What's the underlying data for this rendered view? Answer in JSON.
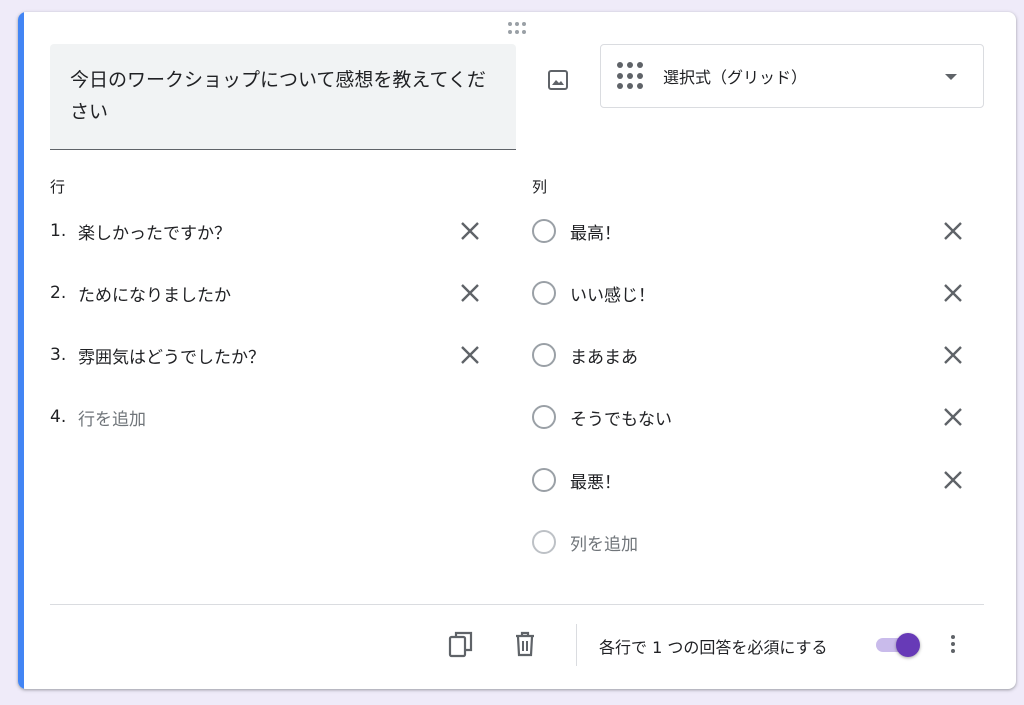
{
  "question": {
    "title": "今日のワークショップについて感想を教えてください",
    "type_label": "選択式（グリッド）"
  },
  "rows": {
    "heading": "行",
    "items": [
      {
        "num": "1.",
        "label": "楽しかったですか？"
      },
      {
        "num": "2.",
        "label": "ためになりましたか"
      },
      {
        "num": "3.",
        "label": "雰囲気はどうでしたか？"
      }
    ],
    "add": {
      "num": "4.",
      "label": "行を追加"
    }
  },
  "columns": {
    "heading": "列",
    "items": [
      {
        "label": "最高！"
      },
      {
        "label": "いい感じ！"
      },
      {
        "label": "まあまあ"
      },
      {
        "label": "そうでもない"
      },
      {
        "label": "最悪！"
      }
    ],
    "add": {
      "label": "列を追加"
    }
  },
  "footer": {
    "required_label": "各行で 1 つの回答を必須にする",
    "required_on": true
  },
  "colors": {
    "accent": "#4285f4",
    "toggle_on": "#673ab7",
    "background": "#efebf9"
  },
  "icons": [
    "drag-handle-icon",
    "image-icon",
    "grid-icon",
    "close-icon",
    "copy-icon",
    "trash-icon",
    "more-vert-icon"
  ]
}
